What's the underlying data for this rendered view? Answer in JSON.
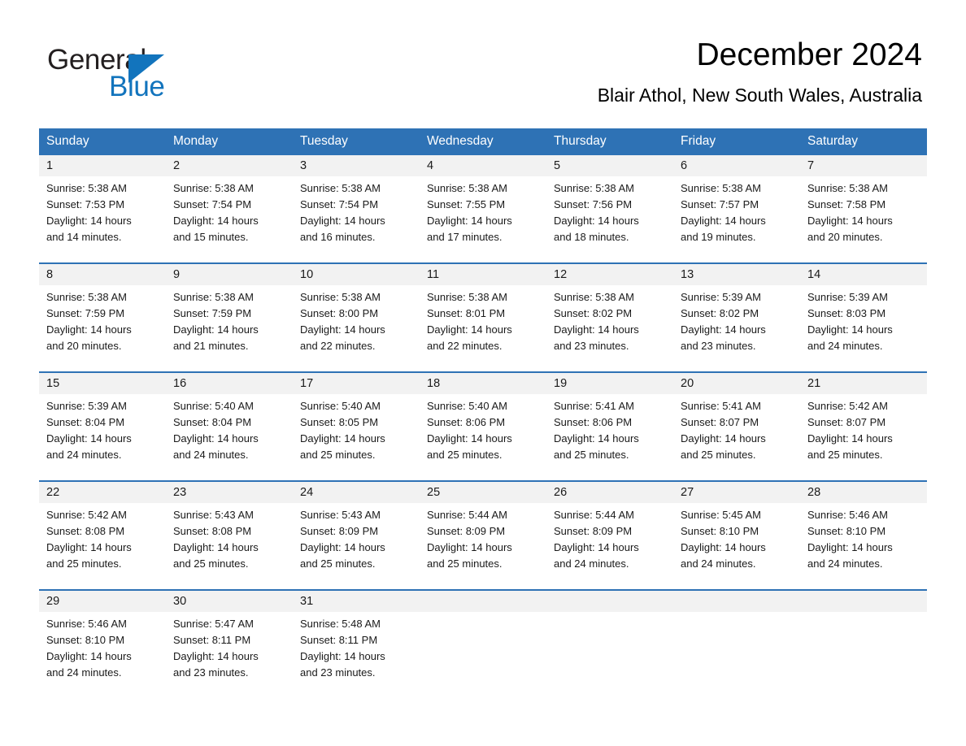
{
  "brand": {
    "name_part1": "General",
    "name_part2": "Blue",
    "mark": "triangle-logo",
    "color_dark": "#231f20",
    "color_blue": "#1274bd"
  },
  "header": {
    "title": "December 2024",
    "subtitle": "Blair Athol, New South Wales, Australia"
  },
  "theme": {
    "header_blue": "#2e72b5",
    "row_band": "#f2f2f2",
    "text": "#1a1a1a"
  },
  "weekdays": [
    "Sunday",
    "Monday",
    "Tuesday",
    "Wednesday",
    "Thursday",
    "Friday",
    "Saturday"
  ],
  "labels": {
    "sunrise_prefix": "Sunrise:",
    "sunset_prefix": "Sunset:",
    "daylight_prefix": "Daylight:"
  },
  "weeks": [
    [
      {
        "day": "1",
        "sunrise": "Sunrise: 5:38 AM",
        "sunset": "Sunset: 7:53 PM",
        "daylight_line1": "Daylight: 14 hours",
        "daylight_line2": "and 14 minutes."
      },
      {
        "day": "2",
        "sunrise": "Sunrise: 5:38 AM",
        "sunset": "Sunset: 7:54 PM",
        "daylight_line1": "Daylight: 14 hours",
        "daylight_line2": "and 15 minutes."
      },
      {
        "day": "3",
        "sunrise": "Sunrise: 5:38 AM",
        "sunset": "Sunset: 7:54 PM",
        "daylight_line1": "Daylight: 14 hours",
        "daylight_line2": "and 16 minutes."
      },
      {
        "day": "4",
        "sunrise": "Sunrise: 5:38 AM",
        "sunset": "Sunset: 7:55 PM",
        "daylight_line1": "Daylight: 14 hours",
        "daylight_line2": "and 17 minutes."
      },
      {
        "day": "5",
        "sunrise": "Sunrise: 5:38 AM",
        "sunset": "Sunset: 7:56 PM",
        "daylight_line1": "Daylight: 14 hours",
        "daylight_line2": "and 18 minutes."
      },
      {
        "day": "6",
        "sunrise": "Sunrise: 5:38 AM",
        "sunset": "Sunset: 7:57 PM",
        "daylight_line1": "Daylight: 14 hours",
        "daylight_line2": "and 19 minutes."
      },
      {
        "day": "7",
        "sunrise": "Sunrise: 5:38 AM",
        "sunset": "Sunset: 7:58 PM",
        "daylight_line1": "Daylight: 14 hours",
        "daylight_line2": "and 20 minutes."
      }
    ],
    [
      {
        "day": "8",
        "sunrise": "Sunrise: 5:38 AM",
        "sunset": "Sunset: 7:59 PM",
        "daylight_line1": "Daylight: 14 hours",
        "daylight_line2": "and 20 minutes."
      },
      {
        "day": "9",
        "sunrise": "Sunrise: 5:38 AM",
        "sunset": "Sunset: 7:59 PM",
        "daylight_line1": "Daylight: 14 hours",
        "daylight_line2": "and 21 minutes."
      },
      {
        "day": "10",
        "sunrise": "Sunrise: 5:38 AM",
        "sunset": "Sunset: 8:00 PM",
        "daylight_line1": "Daylight: 14 hours",
        "daylight_line2": "and 22 minutes."
      },
      {
        "day": "11",
        "sunrise": "Sunrise: 5:38 AM",
        "sunset": "Sunset: 8:01 PM",
        "daylight_line1": "Daylight: 14 hours",
        "daylight_line2": "and 22 minutes."
      },
      {
        "day": "12",
        "sunrise": "Sunrise: 5:38 AM",
        "sunset": "Sunset: 8:02 PM",
        "daylight_line1": "Daylight: 14 hours",
        "daylight_line2": "and 23 minutes."
      },
      {
        "day": "13",
        "sunrise": "Sunrise: 5:39 AM",
        "sunset": "Sunset: 8:02 PM",
        "daylight_line1": "Daylight: 14 hours",
        "daylight_line2": "and 23 minutes."
      },
      {
        "day": "14",
        "sunrise": "Sunrise: 5:39 AM",
        "sunset": "Sunset: 8:03 PM",
        "daylight_line1": "Daylight: 14 hours",
        "daylight_line2": "and 24 minutes."
      }
    ],
    [
      {
        "day": "15",
        "sunrise": "Sunrise: 5:39 AM",
        "sunset": "Sunset: 8:04 PM",
        "daylight_line1": "Daylight: 14 hours",
        "daylight_line2": "and 24 minutes."
      },
      {
        "day": "16",
        "sunrise": "Sunrise: 5:40 AM",
        "sunset": "Sunset: 8:04 PM",
        "daylight_line1": "Daylight: 14 hours",
        "daylight_line2": "and 24 minutes."
      },
      {
        "day": "17",
        "sunrise": "Sunrise: 5:40 AM",
        "sunset": "Sunset: 8:05 PM",
        "daylight_line1": "Daylight: 14 hours",
        "daylight_line2": "and 25 minutes."
      },
      {
        "day": "18",
        "sunrise": "Sunrise: 5:40 AM",
        "sunset": "Sunset: 8:06 PM",
        "daylight_line1": "Daylight: 14 hours",
        "daylight_line2": "and 25 minutes."
      },
      {
        "day": "19",
        "sunrise": "Sunrise: 5:41 AM",
        "sunset": "Sunset: 8:06 PM",
        "daylight_line1": "Daylight: 14 hours",
        "daylight_line2": "and 25 minutes."
      },
      {
        "day": "20",
        "sunrise": "Sunrise: 5:41 AM",
        "sunset": "Sunset: 8:07 PM",
        "daylight_line1": "Daylight: 14 hours",
        "daylight_line2": "and 25 minutes."
      },
      {
        "day": "21",
        "sunrise": "Sunrise: 5:42 AM",
        "sunset": "Sunset: 8:07 PM",
        "daylight_line1": "Daylight: 14 hours",
        "daylight_line2": "and 25 minutes."
      }
    ],
    [
      {
        "day": "22",
        "sunrise": "Sunrise: 5:42 AM",
        "sunset": "Sunset: 8:08 PM",
        "daylight_line1": "Daylight: 14 hours",
        "daylight_line2": "and 25 minutes."
      },
      {
        "day": "23",
        "sunrise": "Sunrise: 5:43 AM",
        "sunset": "Sunset: 8:08 PM",
        "daylight_line1": "Daylight: 14 hours",
        "daylight_line2": "and 25 minutes."
      },
      {
        "day": "24",
        "sunrise": "Sunrise: 5:43 AM",
        "sunset": "Sunset: 8:09 PM",
        "daylight_line1": "Daylight: 14 hours",
        "daylight_line2": "and 25 minutes."
      },
      {
        "day": "25",
        "sunrise": "Sunrise: 5:44 AM",
        "sunset": "Sunset: 8:09 PM",
        "daylight_line1": "Daylight: 14 hours",
        "daylight_line2": "and 25 minutes."
      },
      {
        "day": "26",
        "sunrise": "Sunrise: 5:44 AM",
        "sunset": "Sunset: 8:09 PM",
        "daylight_line1": "Daylight: 14 hours",
        "daylight_line2": "and 24 minutes."
      },
      {
        "day": "27",
        "sunrise": "Sunrise: 5:45 AM",
        "sunset": "Sunset: 8:10 PM",
        "daylight_line1": "Daylight: 14 hours",
        "daylight_line2": "and 24 minutes."
      },
      {
        "day": "28",
        "sunrise": "Sunrise: 5:46 AM",
        "sunset": "Sunset: 8:10 PM",
        "daylight_line1": "Daylight: 14 hours",
        "daylight_line2": "and 24 minutes."
      }
    ],
    [
      {
        "day": "29",
        "sunrise": "Sunrise: 5:46 AM",
        "sunset": "Sunset: 8:10 PM",
        "daylight_line1": "Daylight: 14 hours",
        "daylight_line2": "and 24 minutes."
      },
      {
        "day": "30",
        "sunrise": "Sunrise: 5:47 AM",
        "sunset": "Sunset: 8:11 PM",
        "daylight_line1": "Daylight: 14 hours",
        "daylight_line2": "and 23 minutes."
      },
      {
        "day": "31",
        "sunrise": "Sunrise: 5:48 AM",
        "sunset": "Sunset: 8:11 PM",
        "daylight_line1": "Daylight: 14 hours",
        "daylight_line2": "and 23 minutes."
      },
      {
        "day": "",
        "sunrise": "",
        "sunset": "",
        "daylight_line1": "",
        "daylight_line2": ""
      },
      {
        "day": "",
        "sunrise": "",
        "sunset": "",
        "daylight_line1": "",
        "daylight_line2": ""
      },
      {
        "day": "",
        "sunrise": "",
        "sunset": "",
        "daylight_line1": "",
        "daylight_line2": ""
      },
      {
        "day": "",
        "sunrise": "",
        "sunset": "",
        "daylight_line1": "",
        "daylight_line2": ""
      }
    ]
  ]
}
